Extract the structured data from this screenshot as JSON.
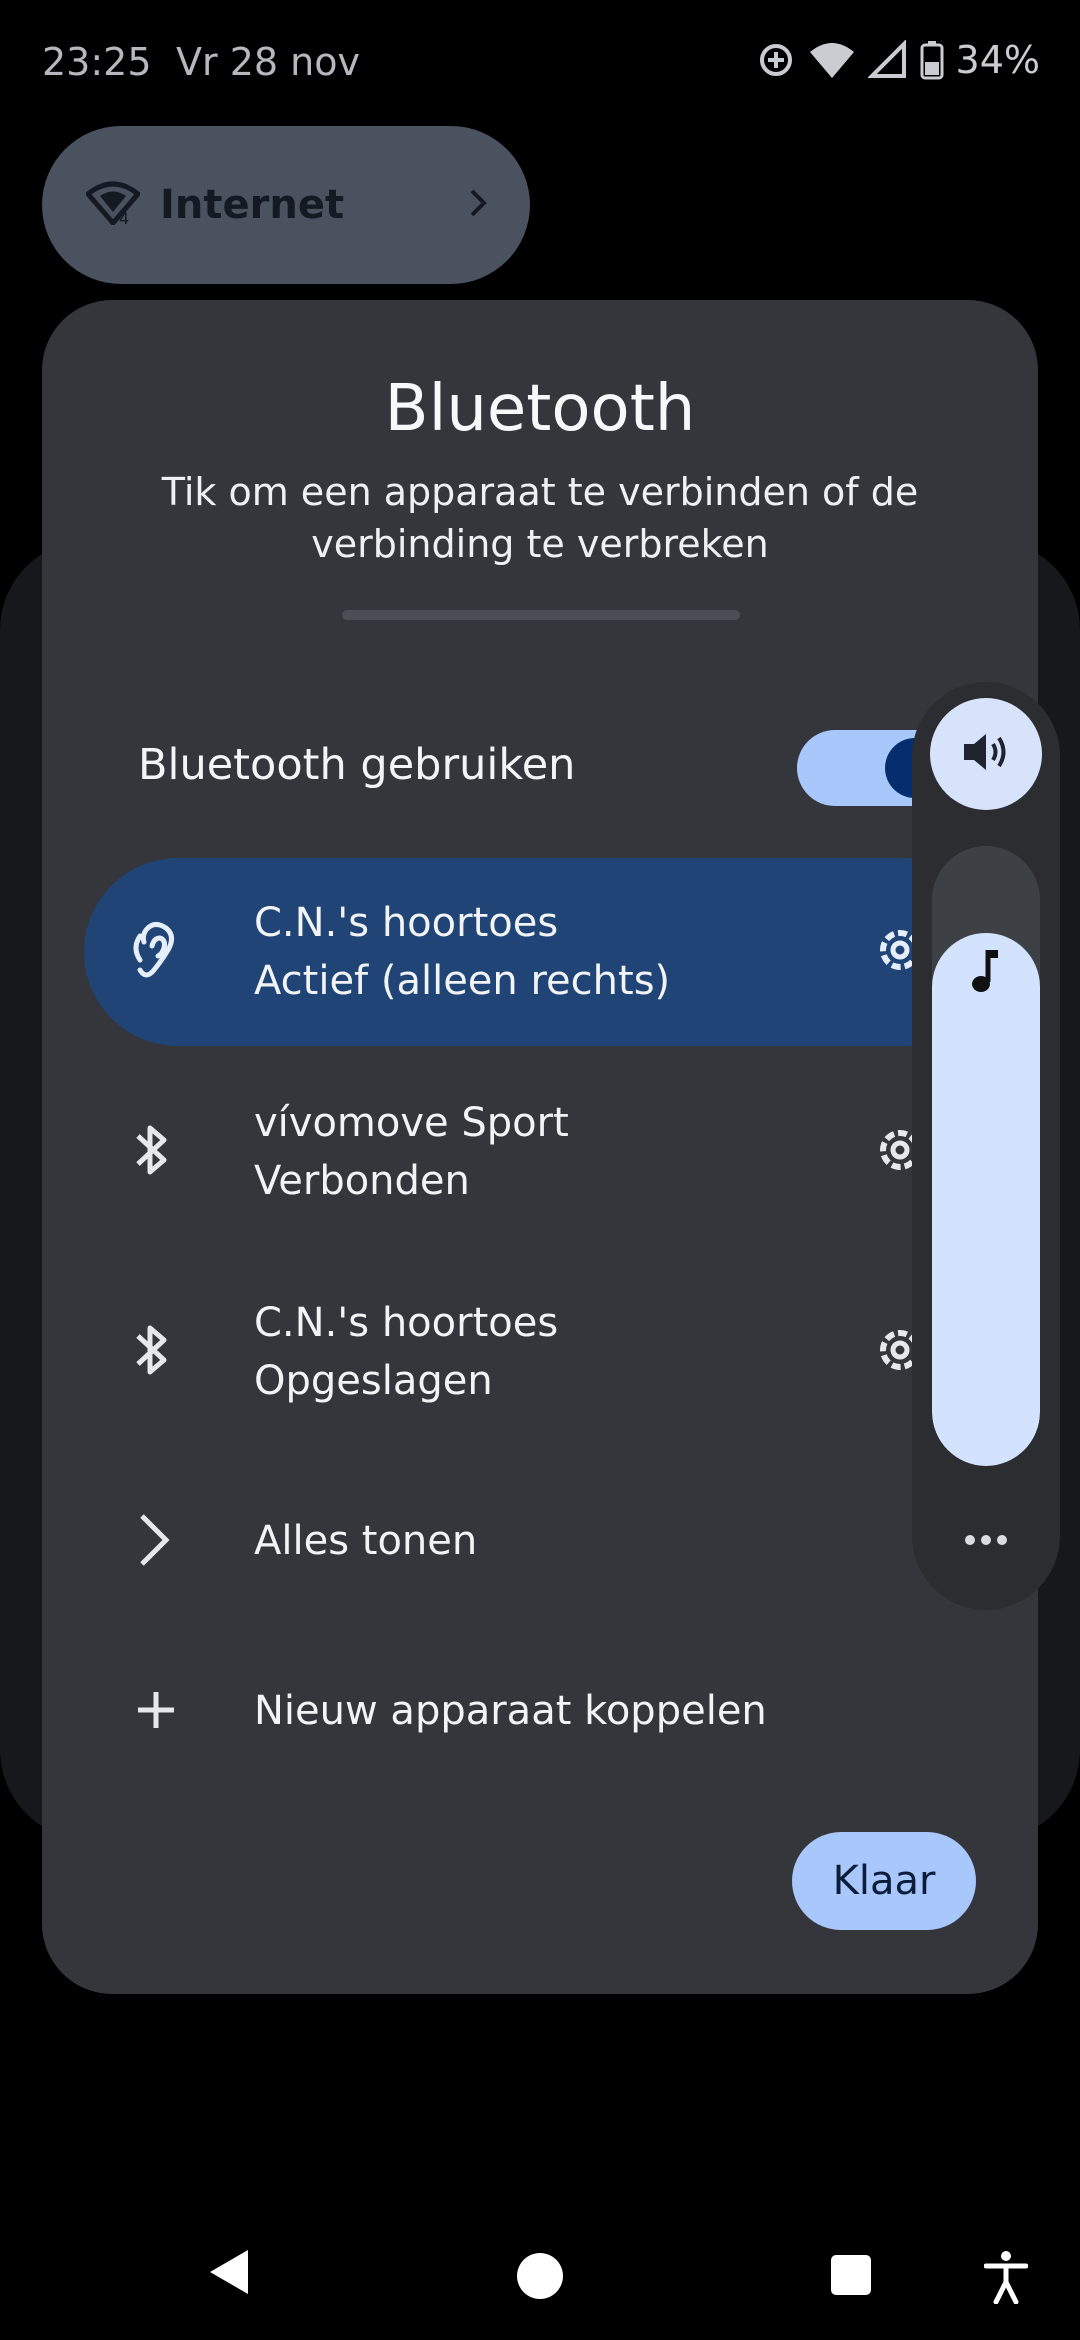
{
  "status_bar": {
    "time": "23:25",
    "date": "Vr 28 nov",
    "battery": "34%",
    "icons": [
      "data-saver-icon",
      "wifi-icon",
      "signal-icon",
      "battery-icon"
    ]
  },
  "internet_tile": {
    "label": "Internet",
    "icons": [
      "wifi-icon",
      "chevron-right-icon"
    ]
  },
  "bluetooth_dialog": {
    "title": "Bluetooth",
    "subtitle": "Tik om een apparaat te verbinden of de verbinding te verbreken",
    "use_bluetooth_label": "Bluetooth gebruiken",
    "toggle_on": true,
    "devices": [
      {
        "name": "C.N.'s hoortoes",
        "status": "Actief (alleen rechts)",
        "icon": "hearing-aid-icon",
        "active": true
      },
      {
        "name": "vívomove Sport",
        "status": "Verbonden",
        "icon": "bluetooth-icon",
        "active": false
      },
      {
        "name": "C.N.'s hoortoes",
        "status": "Opgeslagen",
        "icon": "bluetooth-icon",
        "active": false
      }
    ],
    "show_all_label": "Alles tonen",
    "pair_new_label": "Nieuw apparaat koppelen",
    "done_label": "Klaar"
  },
  "volume_panel": {
    "media_level": 0.86,
    "icons": [
      "speaker-icon",
      "music-note-icon",
      "more-icon"
    ]
  },
  "nav_bar": {
    "icons": [
      "back-icon",
      "home-icon",
      "recents-icon",
      "accessibility-icon"
    ]
  },
  "colors": {
    "accent": "#a8c7fa",
    "active_row": "#1f4475",
    "dialog": "#34363c"
  }
}
